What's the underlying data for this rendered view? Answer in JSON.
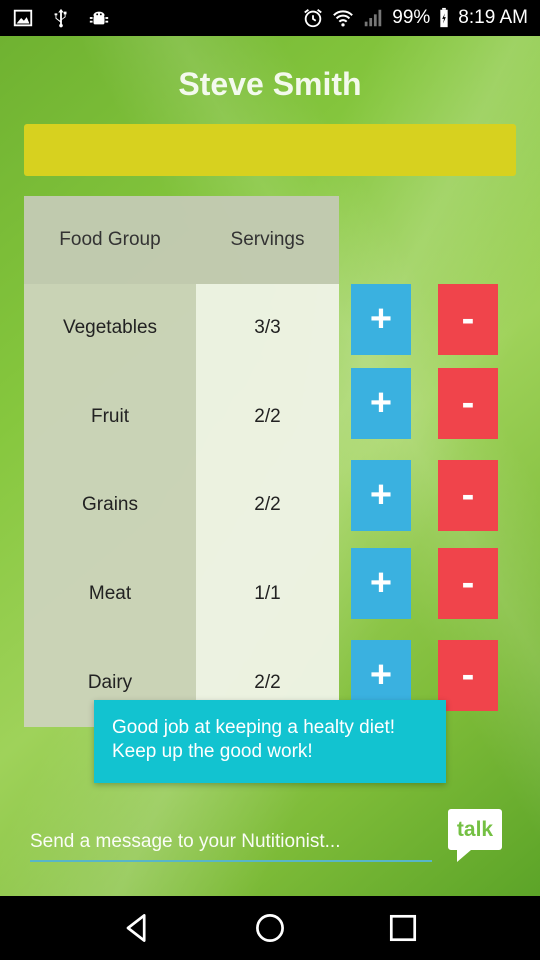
{
  "status_bar": {
    "battery": "99%",
    "time": "8:19 AM",
    "icons": [
      "image-icon",
      "usb-icon",
      "android-debug-icon",
      "alarm-icon",
      "wifi-icon",
      "signal-icon",
      "battery-icon"
    ]
  },
  "header": {
    "user_name": "Steve Smith"
  },
  "table": {
    "headers": [
      "Food Group",
      "Servings"
    ],
    "rows": [
      {
        "group": "Vegetables",
        "servings": "3/3"
      },
      {
        "group": "Fruit",
        "servings": "2/2"
      },
      {
        "group": "Grains",
        "servings": "2/2"
      },
      {
        "group": "Meat",
        "servings": "1/1"
      },
      {
        "group": "Dairy",
        "servings": "2/2"
      }
    ]
  },
  "buttons": {
    "plus_label": "+",
    "minus_label": "-"
  },
  "toast": {
    "line1": "Good job at keeping a healty diet!",
    "line2": "Keep up the good work!"
  },
  "message": {
    "placeholder": "Send a message to your Nutitionist...",
    "talk_label": "talk"
  },
  "colors": {
    "plus": "#3ab1e0",
    "minus": "#f0444b",
    "toast": "#12c3d0",
    "yellow_bar": "#d7d11f",
    "talk_green": "#74c043"
  }
}
